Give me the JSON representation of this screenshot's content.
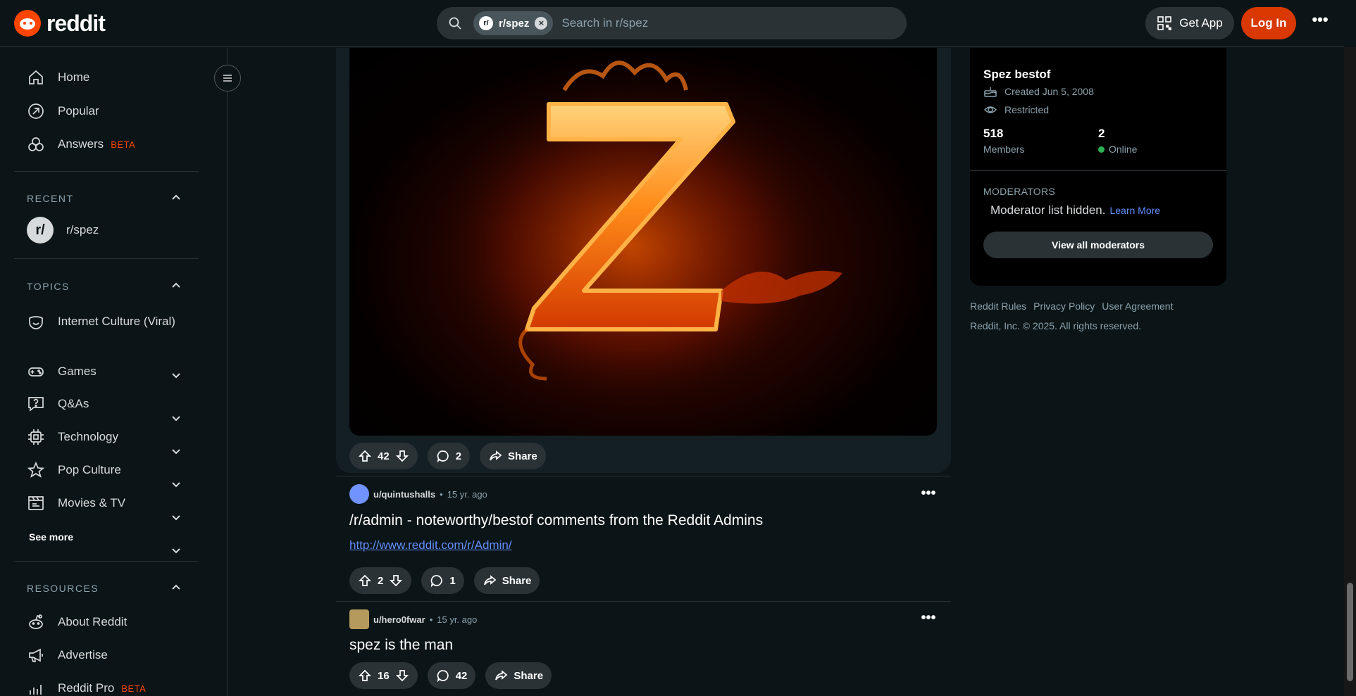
{
  "header": {
    "logo_text": "reddit",
    "search_chip": "r/spez",
    "chip_avatar": "r/",
    "search_placeholder": "Search in r/spez",
    "get_app": "Get App",
    "login": "Log In"
  },
  "sidebar": {
    "nav": [
      {
        "label": "Home",
        "icon": "home-icon"
      },
      {
        "label": "Popular",
        "icon": "popular-icon"
      },
      {
        "label": "Answers",
        "badge": "BETA",
        "icon": "answers-icon"
      }
    ],
    "recent": {
      "title": "RECENT",
      "items": [
        {
          "label": "r/spez",
          "avatar": "r/"
        }
      ]
    },
    "topics": {
      "title": "TOPICS",
      "items": [
        {
          "label": "Internet Culture (Viral)",
          "icon": "smile-icon"
        },
        {
          "label": "Games",
          "icon": "gamepad-icon"
        },
        {
          "label": "Q&As",
          "icon": "question-icon"
        },
        {
          "label": "Technology",
          "icon": "chip-icon"
        },
        {
          "label": "Pop Culture",
          "icon": "star-icon"
        },
        {
          "label": "Movies & TV",
          "icon": "clapper-icon"
        }
      ],
      "see_more": "See more"
    },
    "resources": {
      "title": "RESOURCES",
      "items": [
        {
          "label": "About Reddit",
          "icon": "reddit-icon"
        },
        {
          "label": "Advertise",
          "icon": "megaphone-icon"
        },
        {
          "label": "Reddit Pro",
          "badge": "BETA",
          "icon": "chart-icon"
        }
      ]
    }
  },
  "posts": [
    {
      "upvotes": "42",
      "comments": "2",
      "share": "Share"
    },
    {
      "user": "u/quintushalls",
      "time": "15 yr. ago",
      "title": "/r/admin - noteworthy/bestof comments from the Reddit Admins",
      "link": "http://www.reddit.com/r/Admin/",
      "upvotes": "2",
      "comments": "1",
      "share": "Share"
    },
    {
      "user": "u/hero0fwar",
      "time": "15 yr. ago",
      "title": "spez is the man",
      "upvotes": "16",
      "comments": "42",
      "share": "Share"
    }
  ],
  "community": {
    "name": "Spez bestof",
    "created": "Created Jun 5, 2008",
    "status": "Restricted",
    "members_count": "518",
    "members_label": "Members",
    "online_count": "2",
    "online_label": "Online",
    "moderators_title": "MODERATORS",
    "moderators_hidden": "Moderator list hidden.",
    "learn_more": "Learn More",
    "view_all": "View all moderators"
  },
  "footer": {
    "links": [
      "Reddit Rules",
      "Privacy Policy",
      "User Agreement"
    ],
    "copyright": "Reddit, Inc. © 2025. All rights reserved."
  },
  "colors": {
    "accent": "#ff4500",
    "login": "#d93900",
    "link": "#648efc",
    "online": "#2ab050"
  }
}
